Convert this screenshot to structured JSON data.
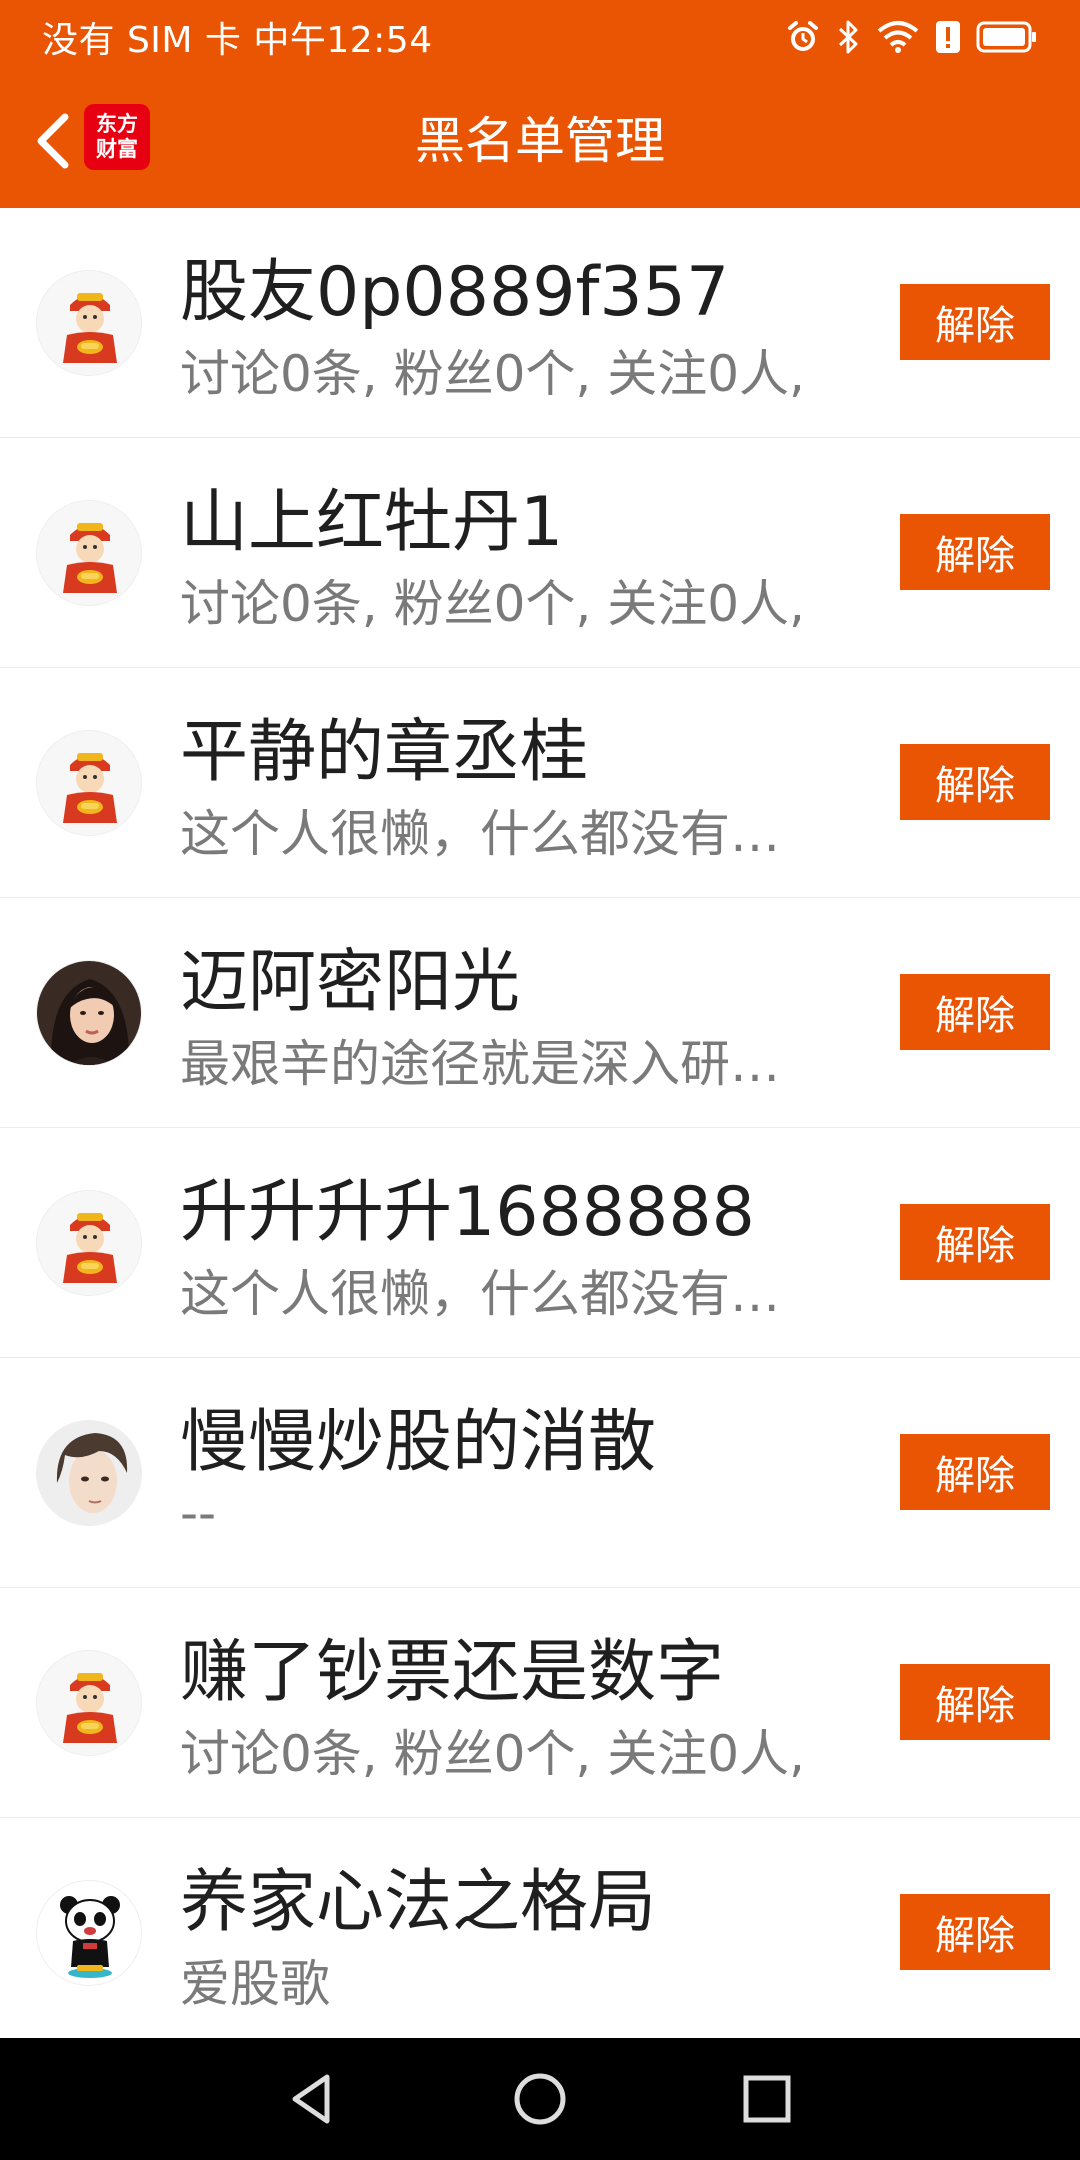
{
  "status_bar": {
    "carrier_time": "没有 SIM 卡 中午12:54",
    "icons": [
      "alarm-icon",
      "bluetooth-icon",
      "wifi-icon",
      "battery-alert-icon",
      "battery-icon"
    ]
  },
  "header": {
    "title": "黑名单管理",
    "logo_line1": "东方",
    "logo_line2": "财富",
    "accent_color": "#ea5504"
  },
  "blacklist": {
    "unblock_label": "解除",
    "items": [
      {
        "name": "股友0p0889f357",
        "desc": "讨论0条, 粉丝0个, 关注0人,",
        "avatar": "fortune-god-avatar"
      },
      {
        "name": "山上红牡丹1",
        "desc": "讨论0条, 粉丝0个, 关注0人,",
        "avatar": "fortune-god-avatar"
      },
      {
        "name": "平静的章丞桂",
        "desc": "这个人很懒，什么都没有…",
        "avatar": "fortune-god-avatar"
      },
      {
        "name": "迈阿密阳光",
        "desc": "最艰辛的途径就是深入研…",
        "avatar": "woman-photo-avatar"
      },
      {
        "name": "升升升升1688888",
        "desc": "这个人很懒，什么都没有…",
        "avatar": "fortune-god-avatar"
      },
      {
        "name": "慢慢炒股的消散",
        "desc": "--",
        "avatar": "man-illustration-avatar"
      },
      {
        "name": "赚了钞票还是数字",
        "desc": "讨论0条, 粉丝0个, 关注0人,",
        "avatar": "fortune-god-avatar"
      },
      {
        "name": "养家心法之格局",
        "desc": "爱股歌",
        "avatar": "panda-avatar"
      }
    ]
  },
  "nav_bar": {
    "buttons": [
      "back-triangle-icon",
      "home-circle-icon",
      "recents-square-icon"
    ]
  }
}
